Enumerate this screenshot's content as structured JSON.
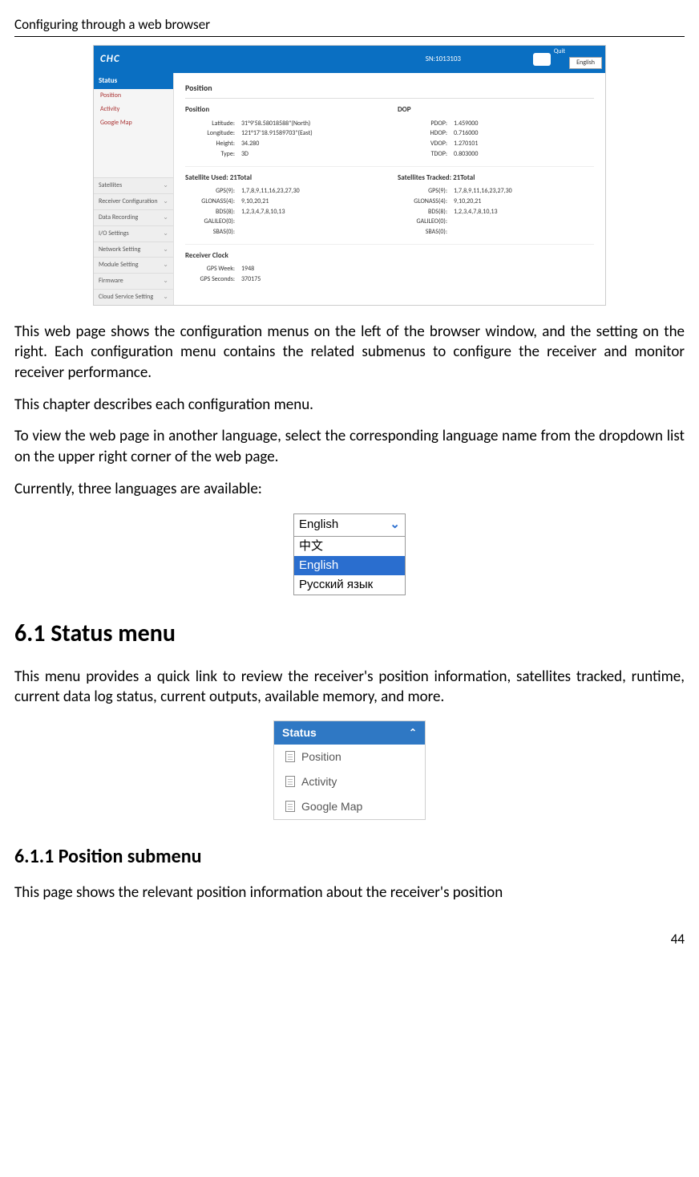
{
  "page_header": "Configuring through a web browser",
  "page_number": "44",
  "screenshot": {
    "logo_text": "CHC",
    "sn_label": "SN:1013103",
    "quit_label": "Quit",
    "lang_selected": "English",
    "sidebar": {
      "active_header": "Status",
      "submenu": [
        "Position",
        "Activity",
        "Google Map"
      ],
      "collapsed": [
        "Satellites",
        "Receiver Configuration",
        "Data Recording",
        "I/O Settings",
        "Network Setting",
        "Module Setting",
        "Firmware",
        "Cloud Service Setting"
      ]
    },
    "panel_title": "Position",
    "position": {
      "heading": "Position",
      "latitude_label": "Latitude:",
      "latitude_value": "31°9'58.58018588\"(North)",
      "longitude_label": "Longitude:",
      "longitude_value": "121°17'18.91589703\"(East)",
      "height_label": "Height:",
      "height_value": "34.280",
      "type_label": "Type:",
      "type_value": "3D"
    },
    "dop": {
      "heading": "DOP",
      "pdop_label": "PDOP:",
      "pdop_value": "1.459000",
      "hdop_label": "HDOP:",
      "hdop_value": "0.716000",
      "vdop_label": "VDOP:",
      "vdop_value": "1.270101",
      "tdop_label": "TDOP:",
      "tdop_value": "0.803000"
    },
    "sat_used": {
      "heading": "Satellite Used:  21Total",
      "gps_label": "GPS(9):",
      "gps_value": "1,7,8,9,11,16,23,27,30",
      "glonass_label": "GLONASS(4):",
      "glonass_value": "9,10,20,21",
      "bds_label": "BDS(8):",
      "bds_value": "1,2,3,4,7,8,10,13",
      "galileo_label": "GALILEO(0):",
      "galileo_value": "",
      "sbas_label": "SBAS(0):",
      "sbas_value": ""
    },
    "sat_tracked": {
      "heading": "Satellites Tracked:  21Total",
      "gps_label": "GPS(9):",
      "gps_value": "1,7,8,9,11,16,23,27,30",
      "glonass_label": "GLONASS(4):",
      "glonass_value": "9,10,20,21",
      "bds_label": "BDS(8):",
      "bds_value": "1,2,3,4,7,8,10,13",
      "galileo_label": "GALILEO(0):",
      "galileo_value": "",
      "sbas_label": "SBAS(0):",
      "sbas_value": ""
    },
    "clock": {
      "heading": "Receiver Clock",
      "week_label": "GPS Week:",
      "week_value": "1948",
      "seconds_label": "GPS Seconds:",
      "seconds_value": "370175"
    }
  },
  "paragraphs": {
    "p1": "This web page shows the configuration menus on the left of the browser window, and the setting on the right. Each configuration menu contains the related submenus to configure the receiver and monitor receiver performance.",
    "p2": "This chapter describes each configuration menu.",
    "p3": "To view the web page in another language, select the corresponding language name from the dropdown list on the upper right corner of the web page.",
    "p4": "Currently, three languages are available:"
  },
  "lang_dropdown": {
    "selected": "English",
    "options": [
      "中文",
      "English",
      "Русский язык"
    ]
  },
  "section_6_1": {
    "title": "6.1  Status menu",
    "body": "This menu provides a quick link to review the receiver's position information, satellites tracked, runtime, current data log status, current outputs, available memory, and more."
  },
  "status_menu_widget": {
    "header": "Status",
    "items": [
      "Position",
      "Activity",
      "Google Map"
    ]
  },
  "section_6_1_1": {
    "title": "6.1.1  Position submenu",
    "body": "This page shows the relevant position information about the receiver's position"
  }
}
